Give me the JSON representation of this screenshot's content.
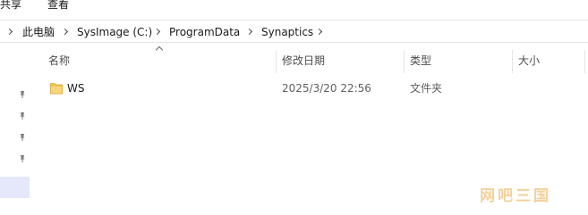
{
  "ribbon": {
    "tabs": [
      "共享",
      "查看"
    ]
  },
  "address_bar": {
    "crumbs": [
      "此电脑",
      "SysImage (C:)",
      "ProgramData",
      "Synaptics"
    ]
  },
  "columns": {
    "name": "名称",
    "modified": "修改日期",
    "type": "类型",
    "size": "大小",
    "sort": "name-ascending"
  },
  "files": [
    {
      "icon": "folder-icon",
      "name": "WS",
      "modified": "2025/3/20 22:56",
      "type": "文件夹",
      "size": ""
    }
  ],
  "nav_pane": {
    "pinned_icons": [
      "pin-icon",
      "pin-icon",
      "pin-icon",
      "pin-icon"
    ]
  },
  "watermark": "网吧三国",
  "colors": {
    "folder": "#f4c95d",
    "selection": "#e5e8fb",
    "watermark": "#f2c98a"
  }
}
